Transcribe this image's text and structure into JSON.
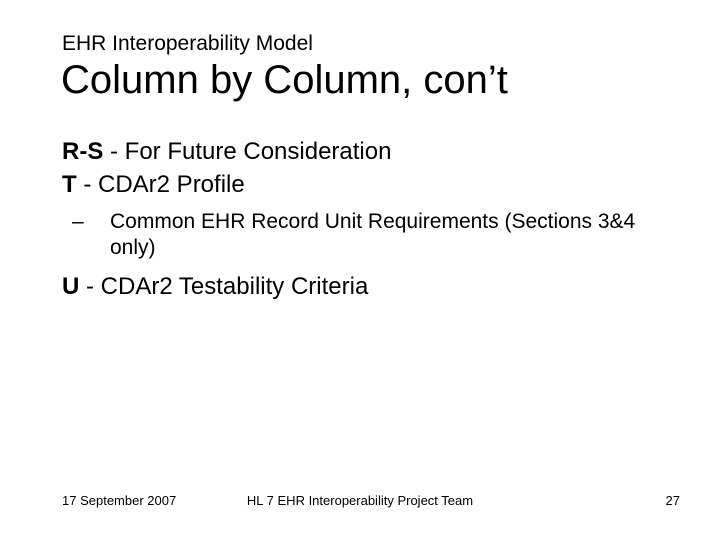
{
  "header": {
    "supertitle": "EHR Interoperability Model",
    "title": "Column by Column, con’t"
  },
  "body": {
    "line1": {
      "label": "R-S",
      "text": " - For Future Consideration"
    },
    "line2": {
      "label": "T",
      "text": " - CDAr2 Profile"
    },
    "sub1": {
      "dash": "–",
      "text": "Common EHR Record Unit Requirements (Sections 3&4 only)"
    },
    "line3": {
      "label": "U",
      "text": " - CDAr2 Testability Criteria"
    }
  },
  "footer": {
    "date": "17 September 2007",
    "center": "HL 7 EHR Interoperability Project Team",
    "page": "27"
  }
}
